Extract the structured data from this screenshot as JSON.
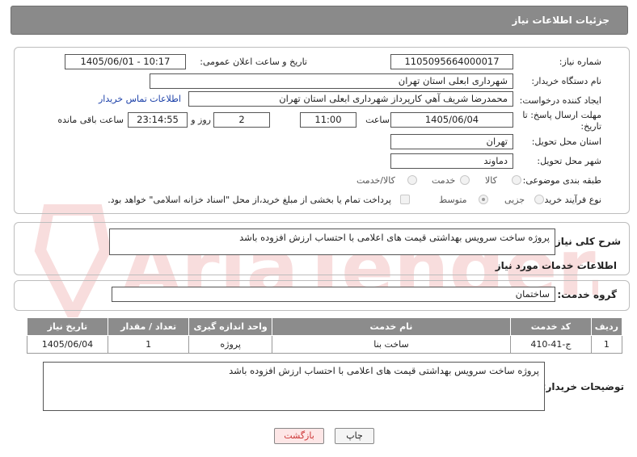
{
  "header": {
    "title": "جزئیات اطلاعات نیاز"
  },
  "labels": {
    "need_number": "شماره نیاز:",
    "announce_datetime": "تاریخ و ساعت اعلان عمومی:",
    "buyer_org": "نام دستگاه خریدار:",
    "creator": "ایجاد کننده درخواست:",
    "deadline_line1": "مهلت ارسال پاسخ: تا",
    "deadline_line2": "تاریخ:",
    "time_word": "ساعت",
    "day_and": "روز و",
    "time_remaining": "ساعت باقی مانده",
    "province": "استان محل تحویل:",
    "city": "شهر محل تحویل:",
    "category": "طبقه بندی موضوعی:",
    "purchase_type": "نوع فرآیند خرید :",
    "general_desc": "شرح کلی نیاز:",
    "services_info": "اطلاعات خدمات مورد نیاز",
    "service_group": "گروه خدمت:",
    "buyer_notes": "توضیحات خریدار:"
  },
  "values": {
    "need_number": "1105095664000017",
    "announce_datetime": "1405/06/01 - 10:17",
    "buyer_org": "شهرداری ابعلی استان تهران",
    "creator": "محمدرضا شریف آهي کارپرداز  شهرداری ابعلی استان تهران",
    "contact_link": "اطلاعات تماس خریدار",
    "deadline_date": "1405/06/04",
    "deadline_time": "11:00",
    "days_remaining": "2",
    "time_left": "23:14:55",
    "province": "تهران",
    "city": "دماوند",
    "general_desc": "پروژه ساخت سرویس بهداشتی قیمت های اعلامی با احتساب ارزش افزوده باشد",
    "service_group": "ساختمان",
    "buyer_notes": "پروژه ساخت سرویس بهداشتی قیمت های اعلامی با احتساب ارزش افزوده باشد"
  },
  "category_options": [
    {
      "label": "کالا",
      "checked": false
    },
    {
      "label": "خدمت",
      "checked": false
    },
    {
      "label": "کالا/خدمت",
      "checked": false
    }
  ],
  "purchase_options": [
    {
      "label": "جزیی",
      "checked": false
    },
    {
      "label": "متوسط",
      "checked": true
    }
  ],
  "payment_note": "پرداخت تمام یا بخشی از مبلغ خرید،از محل \"اسناد خزانه اسلامی\" خواهد بود.",
  "table": {
    "headers": [
      "ردیف",
      "کد خدمت",
      "نام خدمت",
      "واحد اندازه گیری",
      "تعداد / مقدار",
      "تاریخ نیاز"
    ],
    "rows": [
      [
        "1",
        "ج-41-410",
        "ساخت بنا",
        "پروژه",
        "1",
        "1405/06/04"
      ]
    ]
  },
  "buttons": {
    "print": "چاپ",
    "back": "بازگشت"
  },
  "watermark_text": "AriaTender.net"
}
